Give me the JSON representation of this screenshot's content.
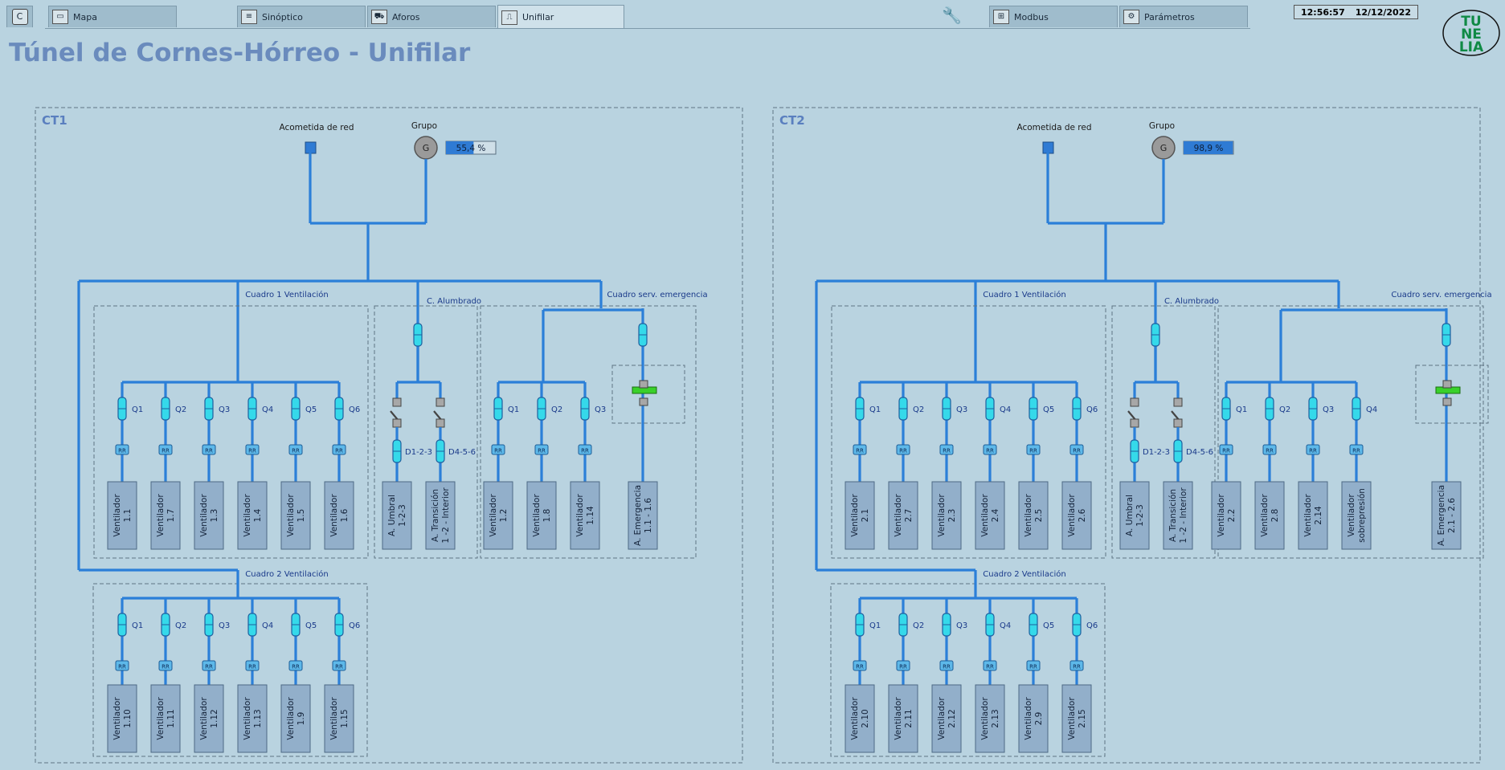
{
  "header": {
    "tabs": [
      {
        "label": "Mapa",
        "icon": "map-icon"
      },
      {
        "label": "Sinóptico",
        "icon": "synoptic-icon"
      },
      {
        "label": "Aforos",
        "icon": "car-icon"
      },
      {
        "label": "Unifilar",
        "icon": "unifilar-icon",
        "active": true
      },
      {
        "label": "Modbus",
        "icon": "network-icon"
      },
      {
        "label": "Parámetros",
        "icon": "gear-icon"
      }
    ],
    "time": "12:56:57",
    "date": "12/12/2022",
    "logo_text": [
      "TU",
      "NE",
      "LIA"
    ]
  },
  "page_title": "Túnel de Cornes-Hórreo - Unifilar",
  "colors": {
    "accent": "#2f7bd4",
    "line": "#2b7fd8",
    "title": "#6a8bbd",
    "switch": "#35d9ea",
    "box": "#92afca"
  },
  "panels": [
    {
      "id": "CT1",
      "label": "CT1",
      "acometida_label": "Acometida de red",
      "grupo_label": "Grupo",
      "grupo_value": "55,4 %",
      "grupo_level": 0.554,
      "cuadro1_label": "Cuadro 1 Ventilación",
      "alumbrado_label": "C. Alumbrado",
      "emergencia_label": "Cuadro serv. emergencia",
      "cuadro2_label": "Cuadro 2 Ventilación",
      "cuadro1": [
        {
          "q": "Q1",
          "load": [
            "Ventilador",
            "1.1"
          ]
        },
        {
          "q": "Q2",
          "load": [
            "Ventilador",
            "1.7"
          ]
        },
        {
          "q": "Q3",
          "load": [
            "Ventilador",
            "1.3"
          ]
        },
        {
          "q": "Q4",
          "load": [
            "Ventilador",
            "1.4"
          ]
        },
        {
          "q": "Q5",
          "load": [
            "Ventilador",
            "1.5"
          ]
        },
        {
          "q": "Q6",
          "load": [
            "Ventilador",
            "1.6"
          ]
        }
      ],
      "alumbrado": [
        {
          "q": "D1-2-3",
          "load": [
            "A. Umbral",
            "1-2-3"
          ]
        },
        {
          "q": "D4-5-6",
          "load": [
            "A. Transición",
            "1 -2 - Interior"
          ]
        }
      ],
      "emergencia": [
        {
          "q": "Q1",
          "load": [
            "Ventilador",
            "1.2"
          ]
        },
        {
          "q": "Q2",
          "load": [
            "Ventilador",
            "1.8"
          ]
        },
        {
          "q": "Q3",
          "load": [
            "Ventilador",
            "1.14"
          ]
        }
      ],
      "emergencia_load": [
        "A. Emergencia",
        "1.1 - 1.6"
      ],
      "cuadro2": [
        {
          "q": "Q1",
          "load": [
            "Ventilador",
            "1.10"
          ]
        },
        {
          "q": "Q2",
          "load": [
            "Ventilador",
            "1.11"
          ]
        },
        {
          "q": "Q3",
          "load": [
            "Ventilador",
            "1.12"
          ]
        },
        {
          "q": "Q4",
          "load": [
            "Ventilador",
            "1.13"
          ]
        },
        {
          "q": "Q5",
          "load": [
            "Ventilador",
            "1.9"
          ]
        },
        {
          "q": "Q6",
          "load": [
            "Ventilador",
            "1.15"
          ]
        }
      ]
    },
    {
      "id": "CT2",
      "label": "CT2",
      "acometida_label": "Acometida de red",
      "grupo_label": "Grupo",
      "grupo_value": "98,9 %",
      "grupo_level": 0.989,
      "cuadro1_label": "Cuadro 1 Ventilación",
      "alumbrado_label": "C. Alumbrado",
      "emergencia_label": "Cuadro serv. emergencia",
      "cuadro2_label": "Cuadro 2 Ventilación",
      "cuadro1": [
        {
          "q": "Q1",
          "load": [
            "Ventilador",
            "2.1"
          ]
        },
        {
          "q": "Q2",
          "load": [
            "Ventilador",
            "2.7"
          ]
        },
        {
          "q": "Q3",
          "load": [
            "Ventilador",
            "2.3"
          ]
        },
        {
          "q": "Q4",
          "load": [
            "Ventilador",
            "2.4"
          ]
        },
        {
          "q": "Q5",
          "load": [
            "Ventilador",
            "2.5"
          ]
        },
        {
          "q": "Q6",
          "load": [
            "Ventilador",
            "2.6"
          ]
        }
      ],
      "alumbrado": [
        {
          "q": "D1-2-3",
          "load": [
            "A. Umbral",
            "1-2-3"
          ]
        },
        {
          "q": "D4-5-6",
          "load": [
            "A. Transición",
            "1 -2 - Interior"
          ]
        }
      ],
      "emergencia": [
        {
          "q": "Q1",
          "load": [
            "Ventilador",
            "2.2"
          ]
        },
        {
          "q": "Q2",
          "load": [
            "Ventilador",
            "2.8"
          ]
        },
        {
          "q": "Q3",
          "load": [
            "Ventilador",
            "2.14"
          ]
        },
        {
          "q": "Q4",
          "load": [
            "Ventilador",
            "sobrepresión"
          ]
        }
      ],
      "emergencia_load": [
        "A. Emergencia",
        "2.1 - 2.6"
      ],
      "cuadro2": [
        {
          "q": "Q1",
          "load": [
            "Ventilador",
            "2.10"
          ]
        },
        {
          "q": "Q2",
          "load": [
            "Ventilador",
            "2.11"
          ]
        },
        {
          "q": "Q3",
          "load": [
            "Ventilador",
            "2.12"
          ]
        },
        {
          "q": "Q4",
          "load": [
            "Ventilador",
            "2.13"
          ]
        },
        {
          "q": "Q5",
          "load": [
            "Ventilador",
            "2.9"
          ]
        },
        {
          "q": "Q6",
          "load": [
            "Ventilador",
            "2.15"
          ]
        }
      ]
    }
  ]
}
